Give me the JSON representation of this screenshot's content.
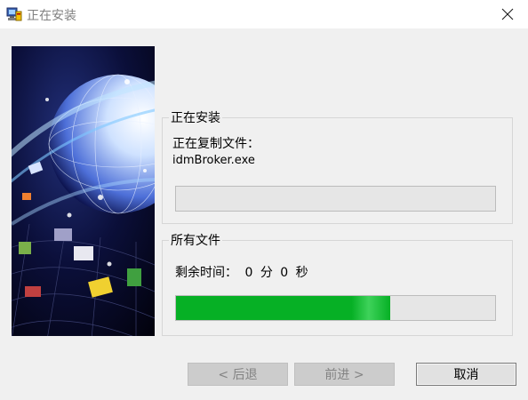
{
  "window": {
    "title": "正在安装",
    "icon": "installer-computer-icon",
    "close_icon": "close-icon"
  },
  "side_image": {
    "description_icon": "globe-network-artwork"
  },
  "install_group": {
    "legend": "正在安装",
    "copying_label": "正在复制文件：",
    "current_file": "idmBroker.exe",
    "progress_fraction": 0.0
  },
  "all_files_group": {
    "legend": "所有文件",
    "time_label": "剩余时间：",
    "minutes": "0",
    "minutes_unit": "分",
    "seconds": "0",
    "seconds_unit": "秒",
    "progress_fraction": 0.67
  },
  "buttons": {
    "back": "< 后退",
    "next": "前进 >",
    "cancel": "取消"
  },
  "colors": {
    "progress_green": "#06b025",
    "window_bg": "#f0f0f0"
  }
}
